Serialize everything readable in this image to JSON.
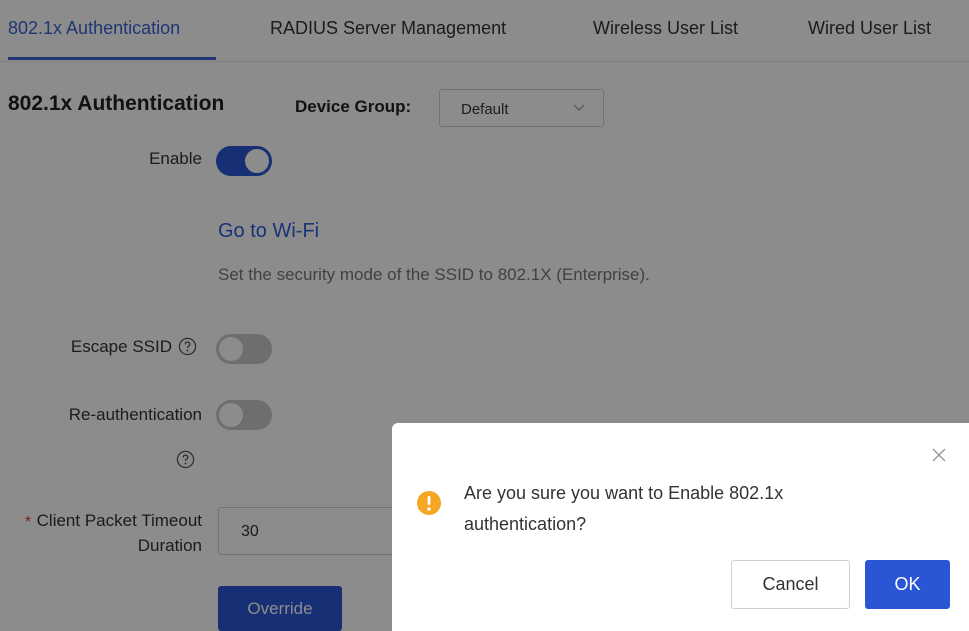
{
  "tabs": [
    {
      "label": "802.1x Authentication",
      "active": true
    },
    {
      "label": "RADIUS Server Management",
      "active": false
    },
    {
      "label": "Wireless User List",
      "active": false
    },
    {
      "label": "Wired User List",
      "active": false
    }
  ],
  "page_title": "802.1x Authentication",
  "device_group": {
    "label": "Device Group:",
    "value": "Default"
  },
  "form": {
    "enable": {
      "label": "Enable",
      "on": true
    },
    "go_to_wifi": "Go to Wi-Fi",
    "hint": "Set the security mode of the SSID to 802.1X (Enterprise).",
    "escape_ssid": {
      "label": "Escape SSID",
      "on": false
    },
    "reauth": {
      "label": "Re-authentication",
      "on": false
    },
    "client_timeout": {
      "label": "Client Packet Timeout Duration",
      "required_mark": "*",
      "value": "30"
    },
    "override_label": "Override"
  },
  "dialog": {
    "message": "Are you sure you want to Enable 802.1x authentication?",
    "cancel_label": "Cancel",
    "ok_label": "OK"
  },
  "colors": {
    "accent": "#2a56d6",
    "warning": "#f5a623",
    "required": "#e03c3c"
  }
}
